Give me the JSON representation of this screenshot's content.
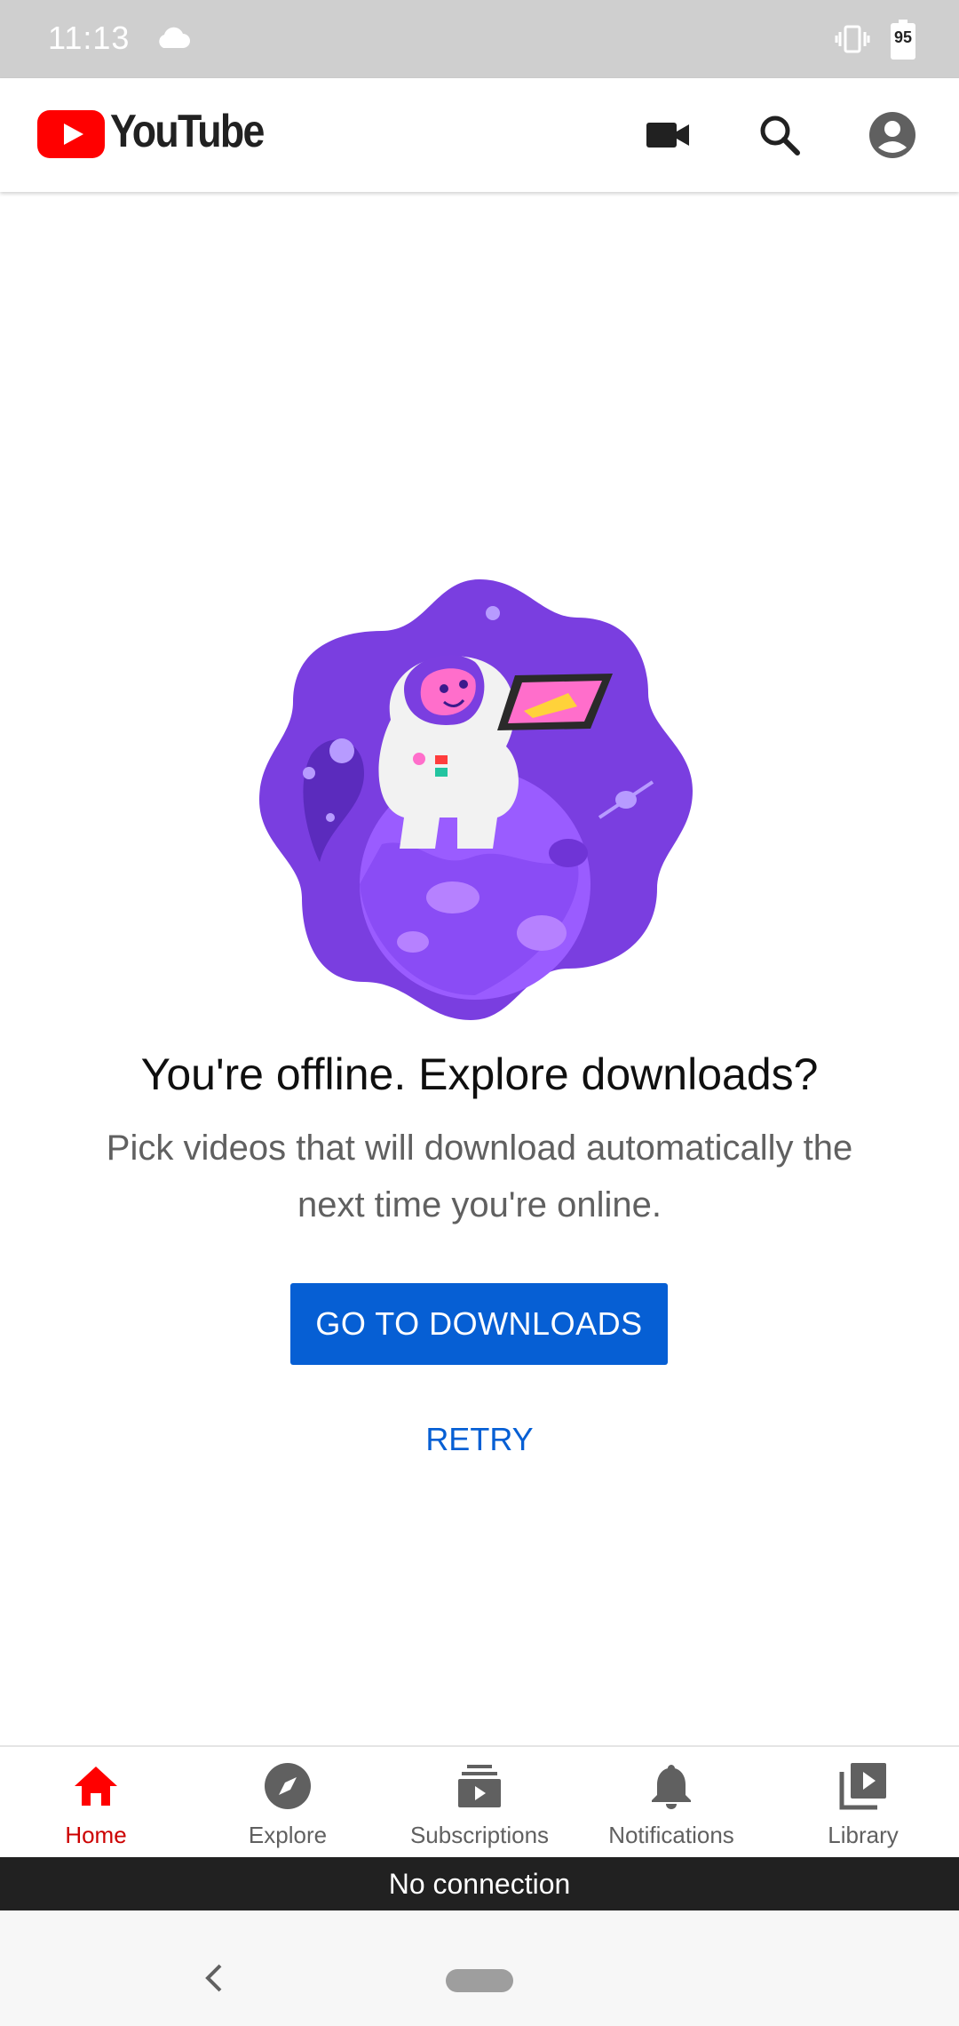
{
  "status_bar": {
    "time": "11:13",
    "battery": "95"
  },
  "app_bar": {
    "brand": "YouTube"
  },
  "main": {
    "headline": "You're offline. Explore downloads?",
    "subtext": "Pick videos that will download automatically the next time you're online.",
    "primary_button": "GO TO DOWNLOADS",
    "retry_button": "RETRY"
  },
  "bottom_nav": {
    "items": [
      {
        "label": "Home",
        "icon": "home-icon",
        "active": true
      },
      {
        "label": "Explore",
        "icon": "explore-icon",
        "active": false
      },
      {
        "label": "Subscriptions",
        "icon": "subscriptions-icon",
        "active": false
      },
      {
        "label": "Notifications",
        "icon": "bell-icon",
        "active": false
      },
      {
        "label": "Library",
        "icon": "library-icon",
        "active": false
      }
    ]
  },
  "snackbar": {
    "text": "No connection"
  },
  "colors": {
    "brand_red": "#ff0000",
    "active_red": "#cc0000",
    "link_blue": "#065fd4"
  }
}
